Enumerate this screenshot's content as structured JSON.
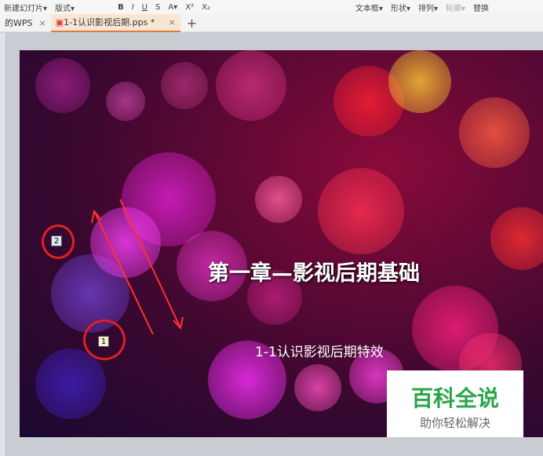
{
  "toolbar": {
    "items": [
      "新建幻灯片▾",
      "版式▾",
      "B",
      "I",
      "U",
      "S",
      "A▾",
      "X²",
      "X₂",
      "文本框▾",
      "形状▾",
      "排列▾",
      "轮廓▾",
      "替换"
    ]
  },
  "tabs": [
    {
      "label": "的WPS"
    },
    {
      "label": "1-1认识影视后期.pps *"
    }
  ],
  "slide": {
    "title": "第一章—影视后期基础",
    "subtitle": "1-1认识影视后期特效"
  },
  "markers": [
    "1",
    "2"
  ],
  "watermark": {
    "title": "百科全说",
    "subtitle": "助你轻松解决"
  }
}
